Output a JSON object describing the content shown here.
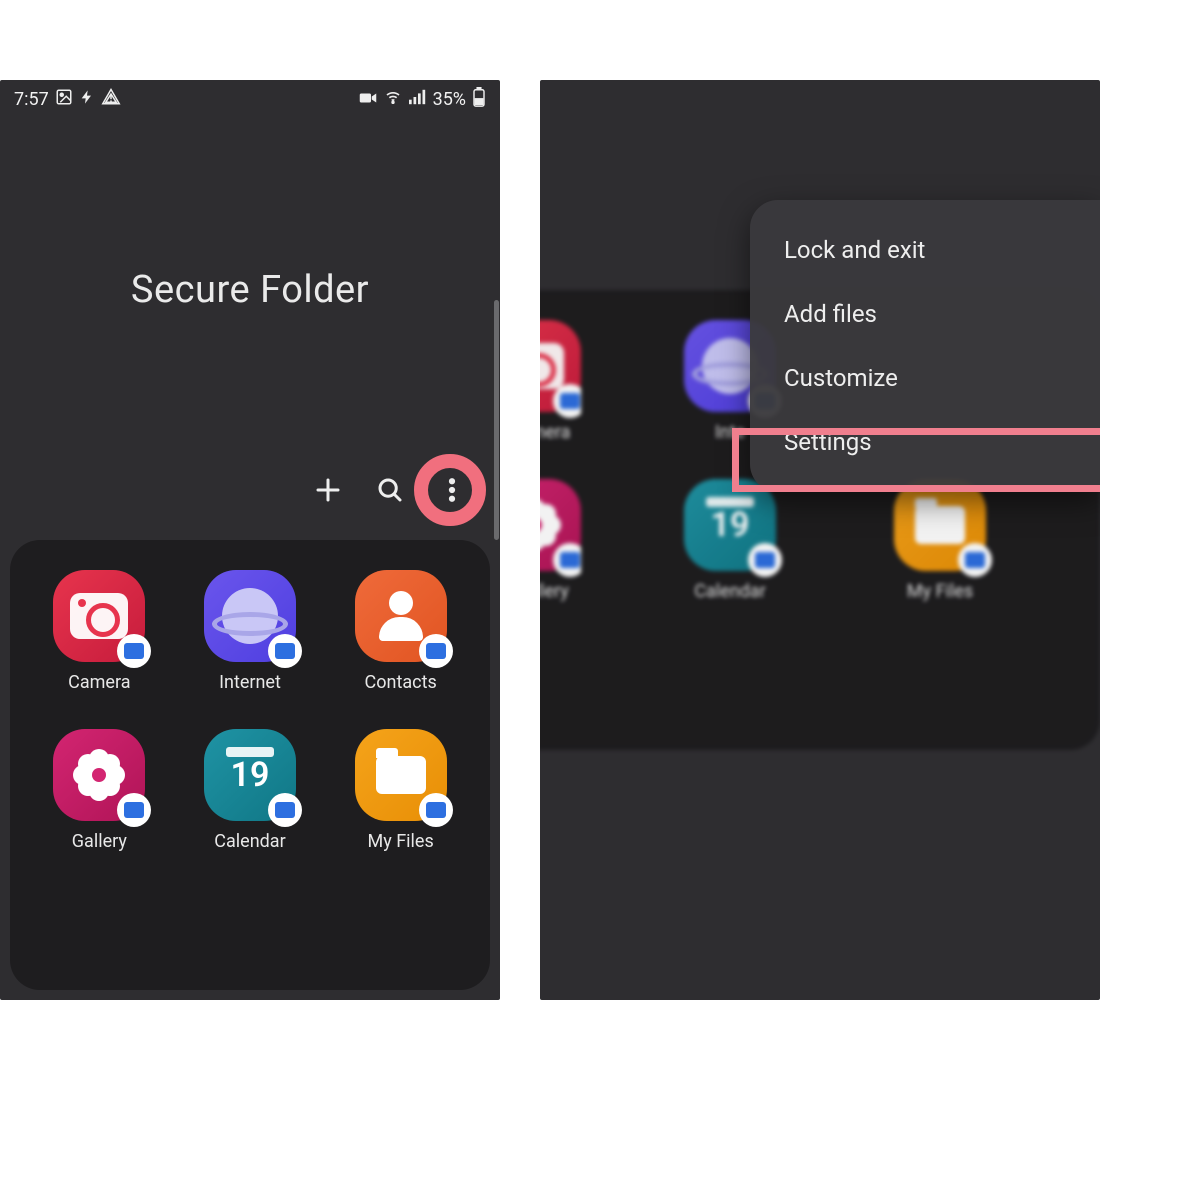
{
  "status_bar": {
    "time": "7:57",
    "battery": "35%"
  },
  "header": {
    "title": "Secure Folder"
  },
  "apps": [
    {
      "key": "camera",
      "label": "Camera"
    },
    {
      "key": "internet",
      "label": "Internet"
    },
    {
      "key": "contacts",
      "label": "Contacts"
    },
    {
      "key": "gallery",
      "label": "Gallery"
    },
    {
      "key": "calendar",
      "label": "Calendar"
    },
    {
      "key": "myfiles",
      "label": "My Files"
    }
  ],
  "calendar_day": "19",
  "right": {
    "apps_visible": [
      {
        "key": "camera",
        "label": "mera"
      },
      {
        "key": "internet",
        "label": "Inte"
      },
      {
        "key": "gallery",
        "label": "illery"
      },
      {
        "key": "calendar",
        "label": "Calendar"
      },
      {
        "key": "myfiles",
        "label": "My Files"
      }
    ]
  },
  "menu": {
    "items": [
      "Lock and exit",
      "Add files",
      "Customize",
      "Settings"
    ],
    "highlighted_index": 3
  }
}
